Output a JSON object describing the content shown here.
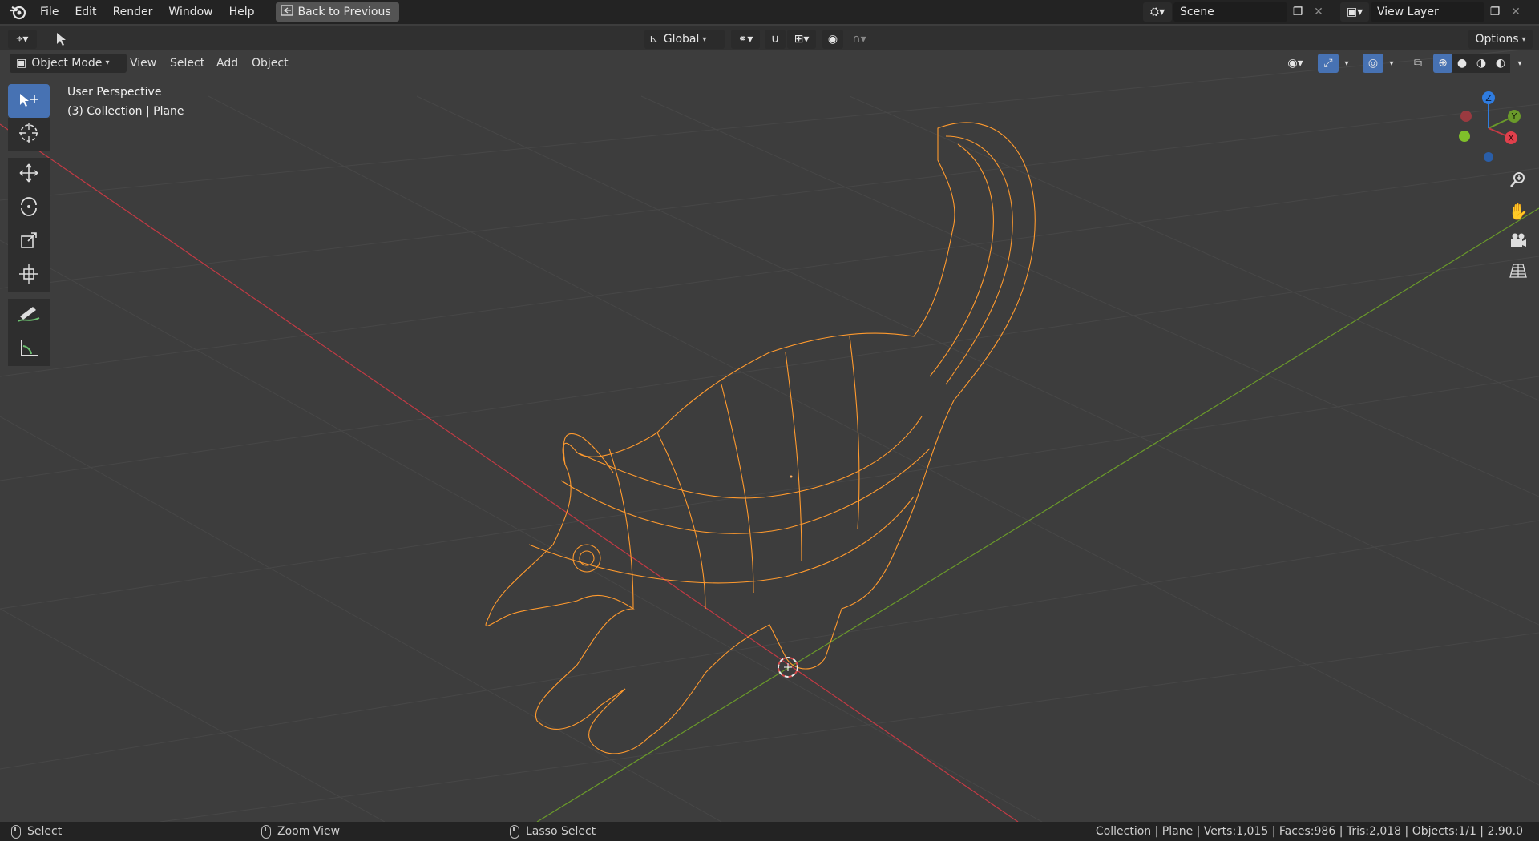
{
  "menu": {
    "items": [
      "File",
      "Edit",
      "Render",
      "Window",
      "Help"
    ],
    "back_label": "Back to Previous"
  },
  "scene": {
    "name": "Scene"
  },
  "view_layer": {
    "name": "View Layer"
  },
  "toolbar": {
    "transform_orientation": "Global",
    "options_label": "Options"
  },
  "viewport_header": {
    "mode": "Object Mode",
    "menus": [
      "View",
      "Select",
      "Add",
      "Object"
    ]
  },
  "viewport": {
    "perspective": "User Perspective",
    "collection_info": "(3) Collection | Plane"
  },
  "tools": [
    "select-box",
    "cursor",
    "move",
    "rotate",
    "scale",
    "transform",
    "annotate",
    "measure"
  ],
  "gizmo": {
    "axis_x": "X",
    "axis_y": "Y",
    "axis_z": "Z"
  },
  "statusbar": {
    "left_action": "Select",
    "middle_action": "Zoom View",
    "right_action": "Lasso Select",
    "stats": "Collection | Plane | Verts:1,015 | Faces:986 | Tris:2,018 | Objects:1/1 | 2.90.0"
  },
  "colors": {
    "wire": "#ff9a2e",
    "x_axis": "#c23a44",
    "y_axis": "#6a9a2a",
    "z_axis": "#2f7ce0",
    "active_tool": "#4772b3"
  }
}
